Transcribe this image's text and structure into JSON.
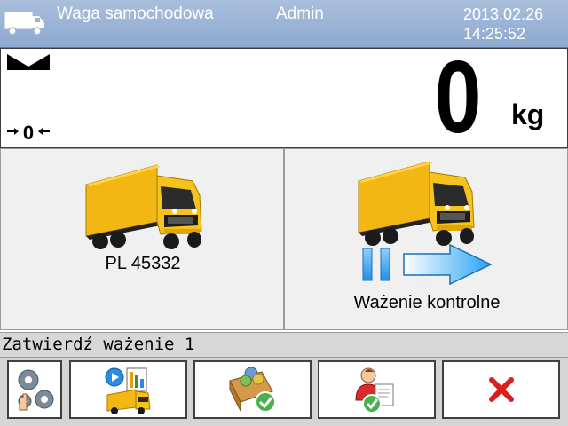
{
  "header": {
    "title": "Waga samochodowa",
    "user": "Admin",
    "date": "2013.02.26",
    "time": "14:25:52",
    "icon": "truck-icon",
    "background_color": "#9db4d6"
  },
  "weight_display": {
    "value": "0",
    "unit": "kg",
    "stability_icon": "stable-indicator-icon",
    "zero_icon": "zero-indicator-icon"
  },
  "tiles": {
    "left": {
      "icon": "truck-icon",
      "label": "PL 45332"
    },
    "right": {
      "icon": "truck-icon",
      "mode_icon": "drive-through-arrow-icon",
      "label": "Ważenie kontrolne"
    }
  },
  "status_bar": {
    "text": "Zatwierdź ważenie 1"
  },
  "toolbar": {
    "buttons": [
      {
        "icon": "settings-gears-icon"
      },
      {
        "icon": "truck-database-icon"
      },
      {
        "icon": "products-confirm-icon"
      },
      {
        "icon": "operator-confirm-icon"
      },
      {
        "icon": "cancel-x-icon",
        "color": "#d81e1e"
      }
    ]
  }
}
